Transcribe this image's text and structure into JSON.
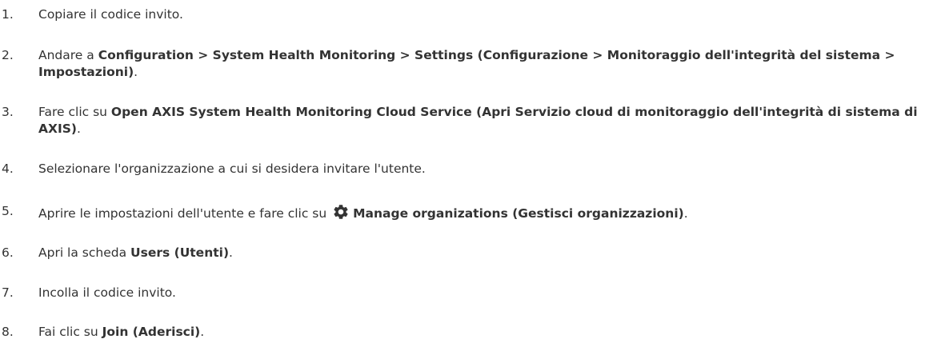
{
  "steps": [
    {
      "num": "1.",
      "parts": [
        {
          "t": "Copiare il codice invito.",
          "b": false
        }
      ]
    },
    {
      "num": "2.",
      "parts": [
        {
          "t": "Andare a ",
          "b": false
        },
        {
          "t": "Configuration > System Health Monitoring > Settings (Configurazione > Monitoraggio dell'integrità del sistema > Impostazioni)",
          "b": true
        },
        {
          "t": ".",
          "b": false
        }
      ]
    },
    {
      "num": "3.",
      "parts": [
        {
          "t": "Fare clic su ",
          "b": false
        },
        {
          "t": "Open AXIS System Health Monitoring Cloud Service (Apri Servizio cloud di monitoraggio dell'integrità di sistema di AXIS)",
          "b": true
        },
        {
          "t": ".",
          "b": false
        }
      ]
    },
    {
      "num": "4.",
      "parts": [
        {
          "t": "Selezionare l'organizzazione a cui si desidera invitare l'utente.",
          "b": false
        }
      ]
    },
    {
      "num": "5.",
      "parts": [
        {
          "t": "Aprire le impostazioni dell'utente e fare clic su ",
          "b": false
        },
        {
          "t": "Manage organizations (Gestisci organizzazioni)",
          "b": true
        },
        {
          "t": ".",
          "b": false
        }
      ],
      "icon": "gear-icon"
    },
    {
      "num": "6.",
      "parts": [
        {
          "t": "Apri la scheda ",
          "b": false
        },
        {
          "t": "Users (Utenti)",
          "b": true
        },
        {
          "t": ".",
          "b": false
        }
      ]
    },
    {
      "num": "7.",
      "parts": [
        {
          "t": "Incolla il codice invito.",
          "b": false
        }
      ]
    },
    {
      "num": "8.",
      "parts": [
        {
          "t": "Fai clic su ",
          "b": false
        },
        {
          "t": "Join (Aderisci)",
          "b": true
        },
        {
          "t": ".",
          "b": false
        }
      ]
    }
  ]
}
